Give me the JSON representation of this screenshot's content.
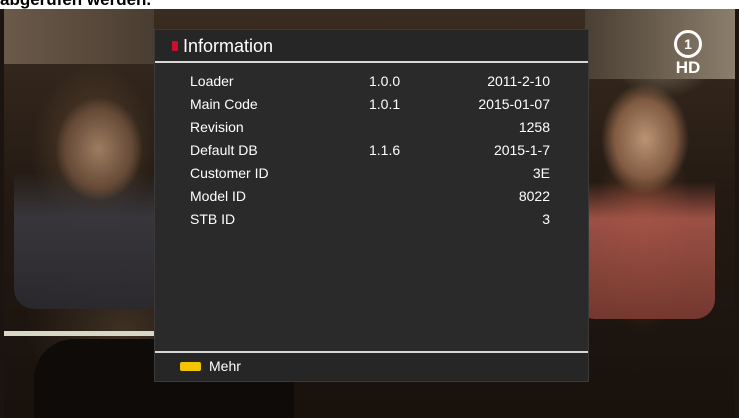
{
  "top_caption": "abgerufen werden.",
  "channel_logo": {
    "symbol": "1",
    "badge": "HD"
  },
  "panel": {
    "title": "Information",
    "header_icon": "red-bullet-icon",
    "rows": [
      {
        "label": "Loader",
        "version": "1.0.0",
        "value": "2011-2-10"
      },
      {
        "label": "Main Code",
        "version": "1.0.1",
        "value": "2015-01-07"
      },
      {
        "label": "Revision",
        "version": "",
        "value": "1258"
      },
      {
        "label": "Default DB",
        "version": "1.1.6",
        "value": "2015-1-7"
      },
      {
        "label": "Customer ID",
        "version": "",
        "value": "3E"
      },
      {
        "label": "Model ID",
        "version": "",
        "value": "8022"
      },
      {
        "label": "STB ID",
        "version": "",
        "value": "3"
      }
    ],
    "footer": {
      "key_color": "#f2c500",
      "key_icon": "yellow-key-icon",
      "label": "Mehr"
    }
  },
  "colors": {
    "panel_bg": "#2a2a2a",
    "accent_red": "#c8102e",
    "yellow": "#f2c500"
  }
}
